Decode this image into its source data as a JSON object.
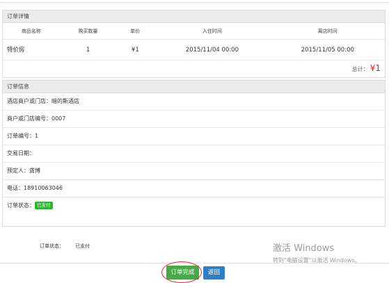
{
  "order_details": {
    "title": "订单详情",
    "columns": [
      "商品名称",
      "购买数量",
      "单价",
      "入住时间",
      "离店时间"
    ],
    "rows": [
      [
        "特价房",
        "1",
        "¥1",
        "2015/11/04 00:00",
        "2015/11/05 00:00"
      ]
    ],
    "total_label": "总计：",
    "total_value": "¥1"
  },
  "order_info": {
    "title": "订单信息",
    "hotel": "酒店商户或门店：暗的斯酒店",
    "store_no": "商户或门店编号：0007",
    "order_no": "订单编号：1",
    "trade_date": "交易日期：",
    "booker": "预定人：龚博",
    "phone": "电话：18910063046",
    "status_label": "订单状态：",
    "status_badge": "已支付"
  },
  "footer_status": {
    "label": "订单状态：",
    "value": "已支付"
  },
  "watermark": {
    "line1": "激活 Windows",
    "line2": "转到\"电脑设置\"以激活 Windows。"
  },
  "buttons": {
    "complete": "订单完成",
    "back": "返回"
  },
  "colors": {
    "complete_button": "#48a948",
    "back_button": "#2f7fc6",
    "badge": "#2db52d",
    "total_amount": "#e02020",
    "annotation_circle": "#e03030"
  }
}
